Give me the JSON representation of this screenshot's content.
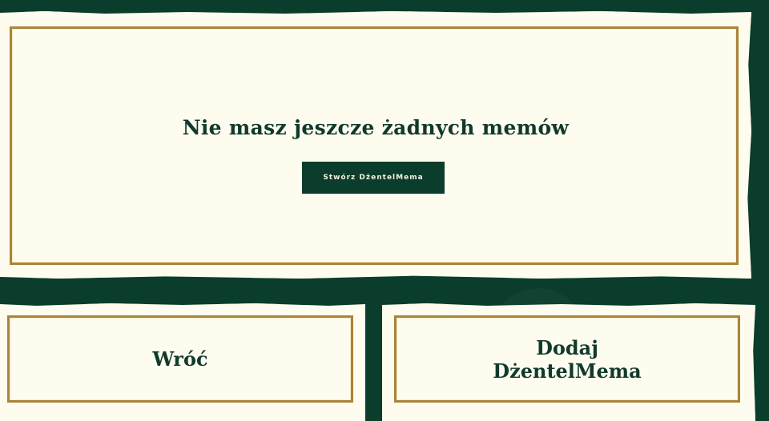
{
  "empty_state": {
    "title": "Nie masz jeszcze żadnych memów",
    "create_button_label": "Stwórz DżentelMema"
  },
  "actions": {
    "back_label": "Wróć",
    "add_label_line1": "Dodaj",
    "add_label_line2": "DżentelMema"
  },
  "colors": {
    "background": "#0a3d2b",
    "card": "#fdfcef",
    "gold_frame": "#a9843b",
    "text": "#103a2b"
  }
}
